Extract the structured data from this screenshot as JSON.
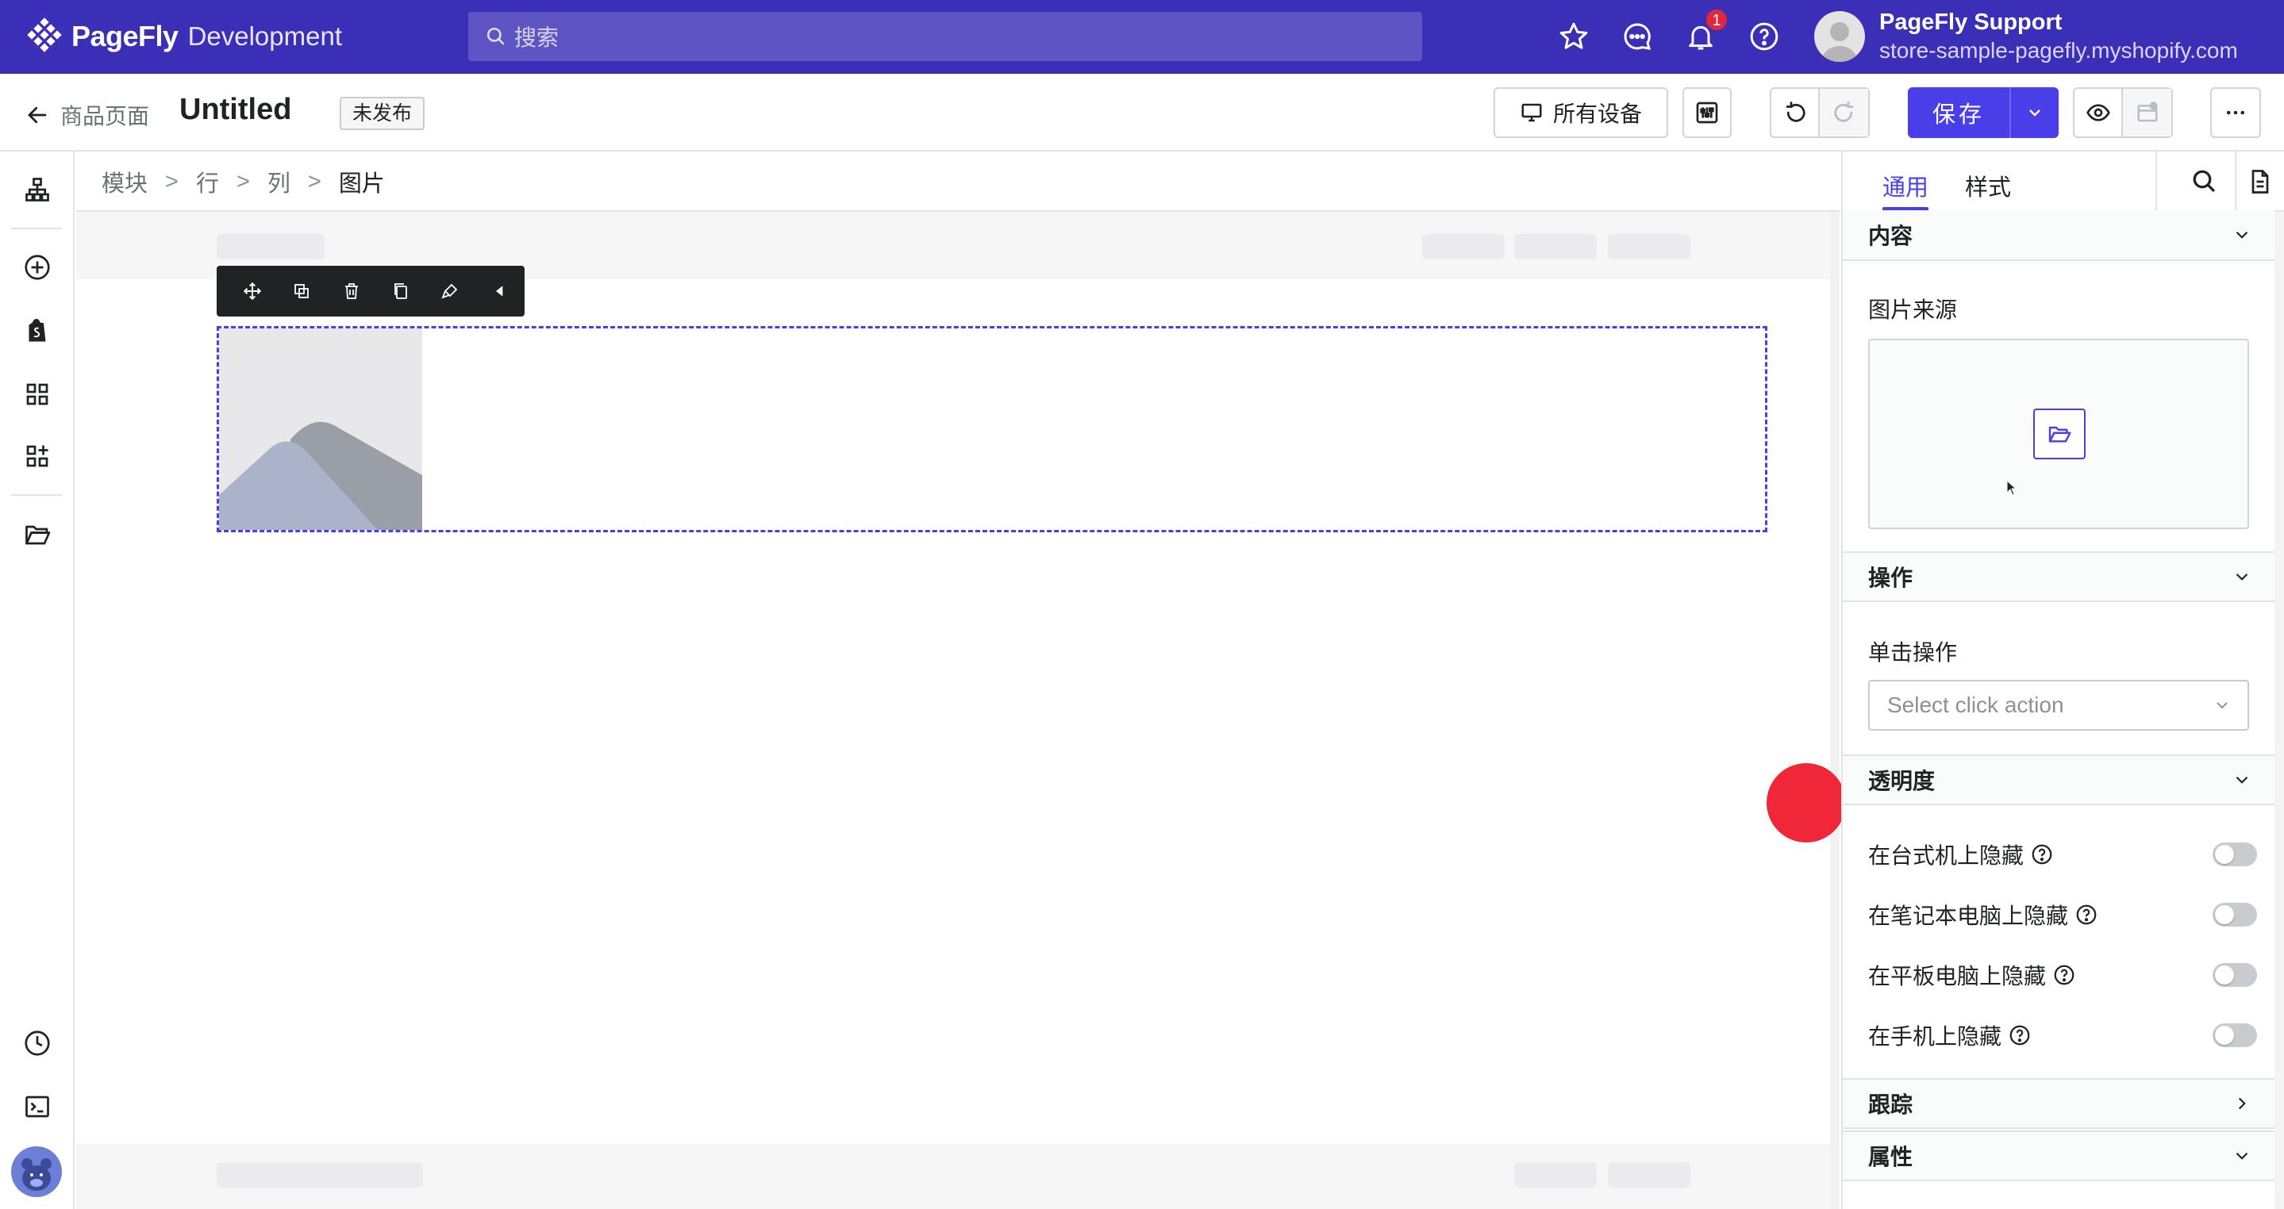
{
  "app": {
    "brand": "PageFly",
    "env": "Development",
    "search_placeholder": "搜索",
    "notification_count": "1",
    "user_name": "PageFly Support",
    "user_store": "store-sample-pagefly.myshopify.com"
  },
  "header": {
    "back_label": "商品页面",
    "title": "Untitled",
    "status": "未发布",
    "device_label": "所有设备",
    "save_label": "保存"
  },
  "breadcrumb": [
    "模块",
    "行",
    "列",
    "图片"
  ],
  "panel": {
    "tabs": [
      "通用",
      "样式"
    ],
    "sections": {
      "content": "内容",
      "actions": "操作",
      "visibility": "透明度",
      "tracking": "跟踪",
      "attributes": "属性"
    },
    "image_source_label": "图片来源",
    "click_action_label": "单击操作",
    "click_action_placeholder": "Select click action",
    "hide_toggles": [
      {
        "label": "在台式机上隐藏",
        "on": false
      },
      {
        "label": "在笔记本电脑上隐藏",
        "on": false
      },
      {
        "label": "在平板电脑上隐藏",
        "on": false
      },
      {
        "label": "在手机上隐藏",
        "on": false
      }
    ]
  },
  "colors": {
    "brand": "#3b2fb8",
    "primary": "#4a3ee8",
    "cursor_dot": "#ef2738"
  }
}
